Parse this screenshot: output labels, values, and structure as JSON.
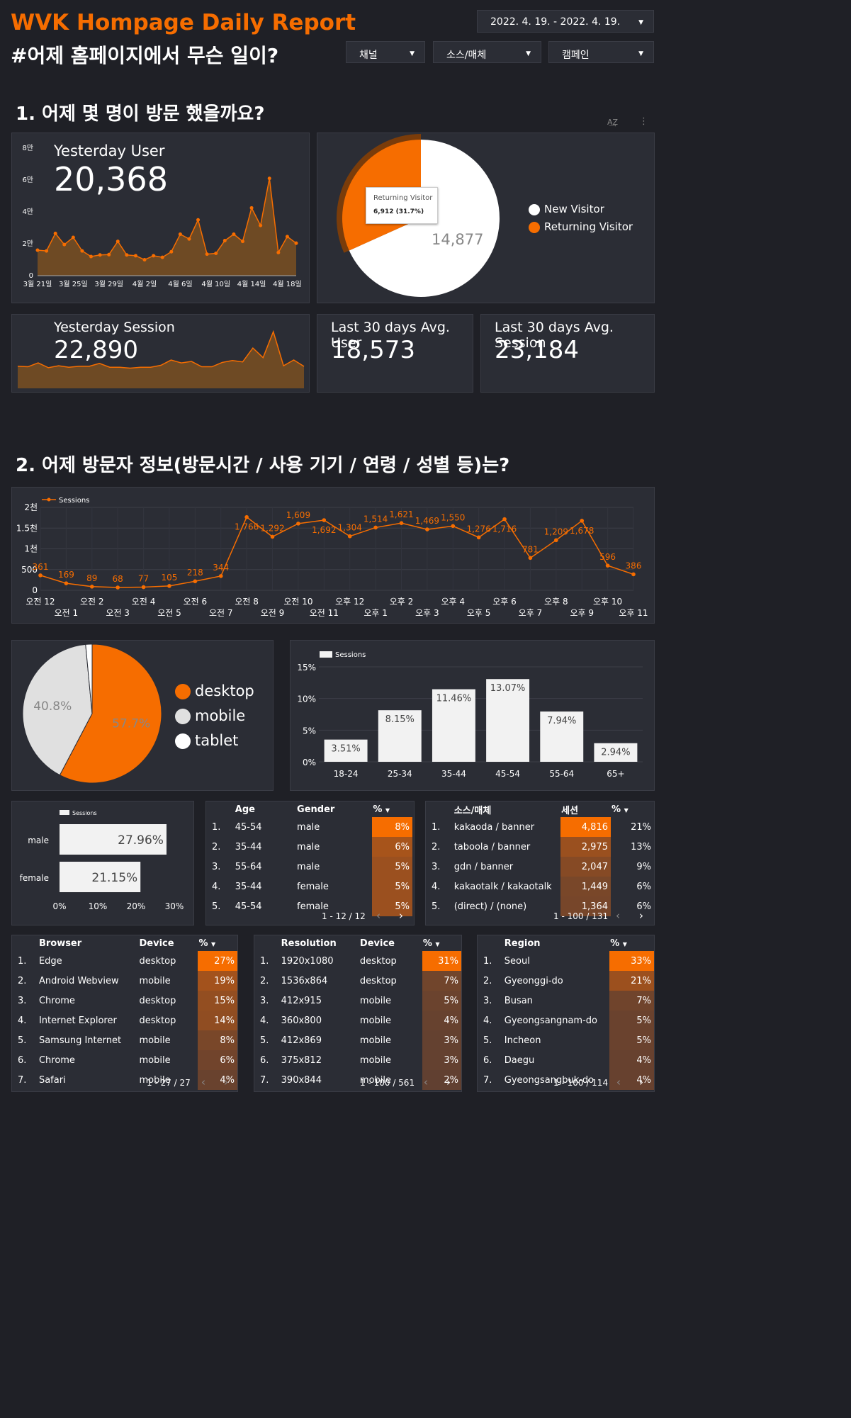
{
  "header": {
    "title": "WVK Hompage Daily Report",
    "subtitle": "#어제 홈페이지에서 무슨 일이?",
    "date_range": "2022. 4. 19. - 2022. 4. 19.",
    "filters": [
      "채널",
      "소스/매체",
      "캠페인"
    ]
  },
  "section1": {
    "title": "1. 어제 몇 명이 방문 했을까요?"
  },
  "section2": {
    "title": "2. 어제 방문자 정보(방문시간 / 사용 기기 / 연령 / 성별 등)는?"
  },
  "kpis": {
    "user_label": "Yesterday User",
    "user_value": "20,368",
    "session_label": "Yesterday Session",
    "session_value": "22,890",
    "avg_user_label": "Last 30 days Avg. User",
    "avg_user_value": "18,573",
    "avg_session_label": "Last 30 days Avg. Session",
    "avg_session_value": "23,184"
  },
  "colors": {
    "accent": "#f66d00",
    "background": "#1f2026",
    "card": "#2b2d35"
  },
  "chart_data": [
    {
      "id": "user_trend",
      "type": "area",
      "y_tick_labels": [
        "0",
        "2만",
        "4만",
        "6만",
        "8만"
      ],
      "ylim": [
        0,
        80000
      ],
      "x_tick_labels": [
        "3월 21일",
        "3월 25일",
        "3월 29일",
        "4월 2일",
        "4월 6일",
        "4월 10일",
        "4월 14일",
        "4월 18일"
      ],
      "values": [
        16000,
        15500,
        26500,
        19500,
        24000,
        15500,
        12000,
        13000,
        13200,
        21500,
        13000,
        12500,
        10000,
        12500,
        11500,
        15000,
        26000,
        23000,
        35000,
        13500,
        14000,
        22000,
        26000,
        21500,
        42500,
        31500,
        61000,
        14500,
        24500,
        20368
      ]
    },
    {
      "id": "visitor_pie",
      "type": "pie",
      "slices": [
        {
          "label": "New Visitor",
          "value": 14877,
          "color": "#ffffff"
        },
        {
          "label": "Returning Visitor",
          "value": 6912,
          "pct": "31.7%",
          "color": "#f66d00"
        }
      ],
      "center_label": "14,877",
      "tooltip_title": "Returning Visitor",
      "tooltip_value": "6,912 (31.7%)"
    },
    {
      "id": "session_trend",
      "type": "area",
      "values": [
        23000,
        22500,
        26500,
        21500,
        23500,
        22000,
        23000,
        23000,
        26000,
        22000,
        22000,
        21000,
        22000,
        22000,
        24000,
        29500,
        26500,
        28000,
        22500,
        22500,
        27000,
        29000,
        27500,
        42000,
        32000,
        59000,
        23500,
        29500,
        22890
      ]
    },
    {
      "id": "hourly_sessions",
      "type": "line",
      "series": [
        {
          "name": "Sessions",
          "values": [
            361,
            169,
            89,
            68,
            77,
            105,
            218,
            344,
            1766,
            1292,
            1609,
            1692,
            1304,
            1514,
            1621,
            1469,
            1550,
            1276,
            1716,
            781,
            1209,
            1678,
            596,
            386
          ]
        }
      ],
      "data_labels": [
        "361",
        "169",
        "89",
        "68",
        "77",
        "105",
        "218",
        "344",
        "1,766",
        "1,292",
        "1,609",
        "1,692",
        "1,304",
        "1,514",
        "1,621",
        "1,469",
        "1,550",
        "1,276",
        "1,716",
        "781",
        "1,209",
        "1,678",
        "596",
        "386"
      ],
      "categories": [
        "오전 12",
        "오전 1",
        "오전 2",
        "오전 3",
        "오전 4",
        "오전 5",
        "오전 6",
        "오전 7",
        "오전 8",
        "오전 9",
        "오전 10",
        "오전 11",
        "오후 12",
        "오후 1",
        "오후 2",
        "오후 3",
        "오후 4",
        "오후 5",
        "오후 6",
        "오후 7",
        "오후 8",
        "오후 9",
        "오후 10",
        "오후 11"
      ],
      "y_tick_labels": [
        "0",
        "500",
        "1천",
        "1.5천",
        "2천"
      ],
      "ylim": [
        0,
        2000
      ]
    },
    {
      "id": "device_pie",
      "type": "pie",
      "slices": [
        {
          "label": "desktop",
          "value": 57.7,
          "pct": "57.7%",
          "color": "#f66d00"
        },
        {
          "label": "mobile",
          "value": 40.8,
          "pct": "40.8%",
          "color": "#e0e0e0"
        },
        {
          "label": "tablet",
          "value": 1.5,
          "color": "#ffffff"
        }
      ]
    },
    {
      "id": "age_bars",
      "type": "bar",
      "series": [
        {
          "name": "Sessions",
          "values": [
            3.51,
            8.15,
            11.46,
            13.07,
            7.94,
            2.94
          ]
        }
      ],
      "categories": [
        "18-24",
        "25-34",
        "35-44",
        "45-54",
        "55-64",
        "65+"
      ],
      "value_labels": [
        "3.51%",
        "8.15%",
        "11.46%",
        "13.07%",
        "7.94%",
        "2.94%"
      ],
      "y_tick_labels": [
        "0%",
        "5%",
        "10%",
        "15%"
      ],
      "ylim": [
        0,
        15
      ]
    },
    {
      "id": "gender_bars",
      "type": "bar",
      "series": [
        {
          "name": "Sessions",
          "values": [
            27.96,
            21.15
          ]
        }
      ],
      "categories": [
        "male",
        "female"
      ],
      "value_labels": [
        "27.96%",
        "21.15%"
      ],
      "x_tick_labels": [
        "0%",
        "10%",
        "20%",
        "30%"
      ],
      "xlim": [
        0,
        30
      ]
    }
  ],
  "tables": {
    "age_gender": {
      "headers": [
        "Age",
        "Gender",
        "%"
      ],
      "rows": [
        {
          "n": "1.",
          "a": "45-54",
          "b": "male",
          "p": "8%",
          "v": 8
        },
        {
          "n": "2.",
          "a": "35-44",
          "b": "male",
          "p": "6%",
          "v": 6
        },
        {
          "n": "3.",
          "a": "55-64",
          "b": "male",
          "p": "5%",
          "v": 5
        },
        {
          "n": "4.",
          "a": "35-44",
          "b": "female",
          "p": "5%",
          "v": 5
        },
        {
          "n": "5.",
          "a": "45-54",
          "b": "female",
          "p": "5%",
          "v": 5
        }
      ],
      "pager": "1 - 12 / 12"
    },
    "source": {
      "headers": [
        "소스/매체",
        "세션",
        "%"
      ],
      "rows": [
        {
          "n": "1.",
          "a": "kakaoda / banner",
          "b": "4,816",
          "p": "21%",
          "v": 4816
        },
        {
          "n": "2.",
          "a": "taboola / banner",
          "b": "2,975",
          "p": "13%",
          "v": 2975
        },
        {
          "n": "3.",
          "a": "gdn / banner",
          "b": "2,047",
          "p": "9%",
          "v": 2047
        },
        {
          "n": "4.",
          "a": "kakaotalk / kakaotalk",
          "b": "1,449",
          "p": "6%",
          "v": 1449
        },
        {
          "n": "5.",
          "a": "(direct) / (none)",
          "b": "1,364",
          "p": "6%",
          "v": 1364
        }
      ],
      "pager": "1 - 100 / 131"
    },
    "browser": {
      "headers": [
        "Browser",
        "Device",
        "%"
      ],
      "rows": [
        {
          "n": "1.",
          "a": "Edge",
          "b": "desktop",
          "p": "27%",
          "v": 27
        },
        {
          "n": "2.",
          "a": "Android Webview",
          "b": "mobile",
          "p": "19%",
          "v": 19
        },
        {
          "n": "3.",
          "a": "Chrome",
          "b": "desktop",
          "p": "15%",
          "v": 15
        },
        {
          "n": "4.",
          "a": "Internet Explorer",
          "b": "desktop",
          "p": "14%",
          "v": 14
        },
        {
          "n": "5.",
          "a": "Samsung Internet",
          "b": "mobile",
          "p": "8%",
          "v": 8
        },
        {
          "n": "6.",
          "a": "Chrome",
          "b": "mobile",
          "p": "6%",
          "v": 6
        },
        {
          "n": "7.",
          "a": "Safari",
          "b": "mobile",
          "p": "4%",
          "v": 4
        }
      ],
      "pager": "1 - 27 / 27"
    },
    "resolution": {
      "headers": [
        "Resolution",
        "Device",
        "%"
      ],
      "rows": [
        {
          "n": "1.",
          "a": "1920x1080",
          "b": "desktop",
          "p": "31%",
          "v": 31
        },
        {
          "n": "2.",
          "a": "1536x864",
          "b": "desktop",
          "p": "7%",
          "v": 7
        },
        {
          "n": "3.",
          "a": "412x915",
          "b": "mobile",
          "p": "5%",
          "v": 5
        },
        {
          "n": "4.",
          "a": "360x800",
          "b": "mobile",
          "p": "4%",
          "v": 4
        },
        {
          "n": "5.",
          "a": "412x869",
          "b": "mobile",
          "p": "3%",
          "v": 3
        },
        {
          "n": "6.",
          "a": "375x812",
          "b": "mobile",
          "p": "3%",
          "v": 3
        },
        {
          "n": "7.",
          "a": "390x844",
          "b": "mobile",
          "p": "2%",
          "v": 2
        }
      ],
      "pager": "1 - 100 / 561"
    },
    "region": {
      "headers": [
        "Region",
        "%"
      ],
      "rows": [
        {
          "n": "1.",
          "a": "Seoul",
          "p": "33%",
          "v": 33
        },
        {
          "n": "2.",
          "a": "Gyeonggi-do",
          "p": "21%",
          "v": 21
        },
        {
          "n": "3.",
          "a": "Busan",
          "p": "7%",
          "v": 7
        },
        {
          "n": "4.",
          "a": "Gyeongsangnam-do",
          "p": "5%",
          "v": 5
        },
        {
          "n": "5.",
          "a": "Incheon",
          "p": "5%",
          "v": 5
        },
        {
          "n": "6.",
          "a": "Daegu",
          "p": "4%",
          "v": 4
        },
        {
          "n": "7.",
          "a": "Gyeongsangbuk-do",
          "p": "4%",
          "v": 4
        }
      ],
      "pager": "1 - 100 / 114"
    }
  }
}
